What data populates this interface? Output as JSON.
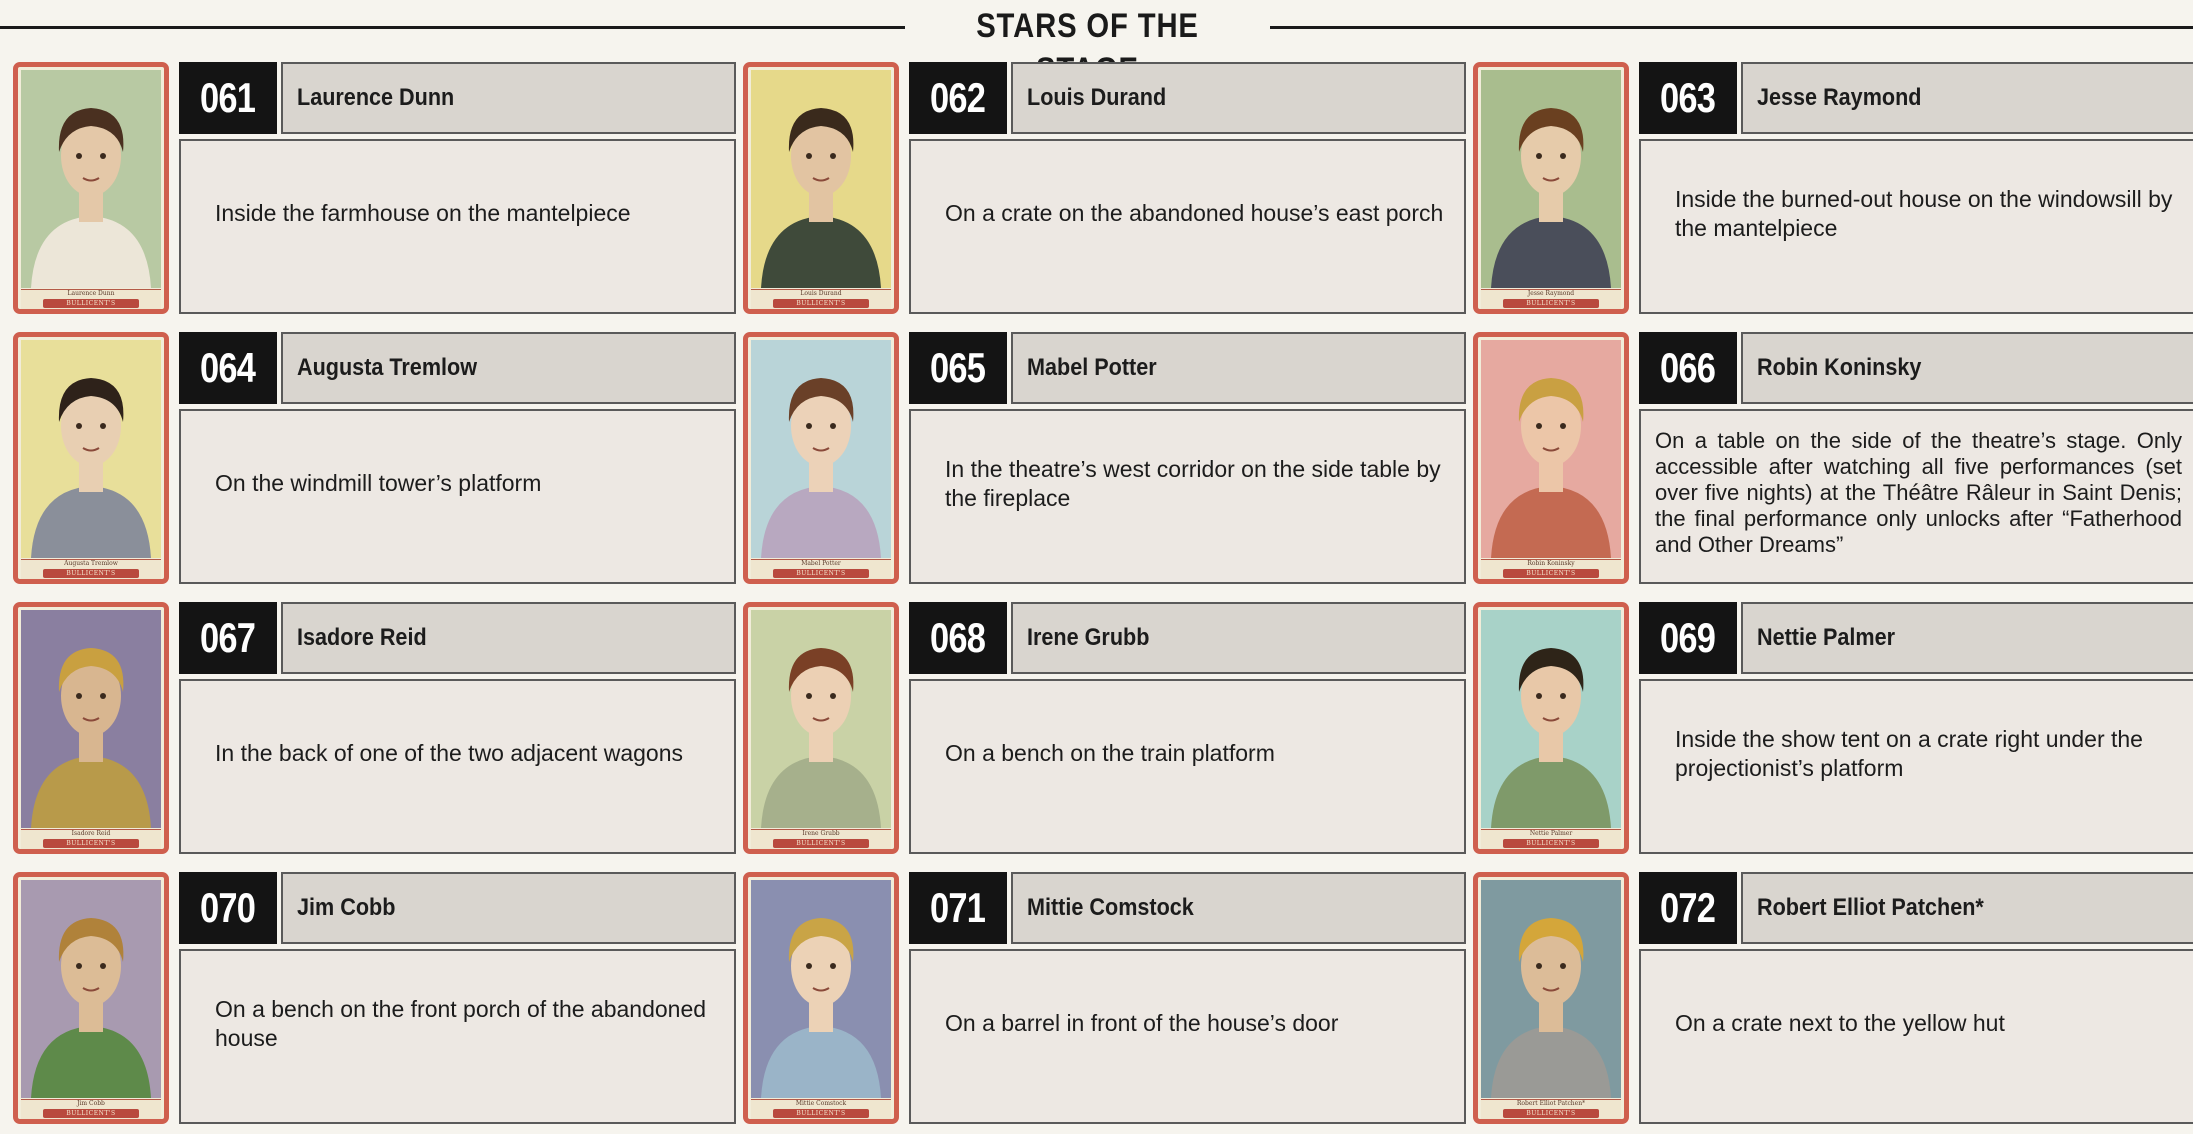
{
  "title": "STARS OF THE STAGE",
  "card_brand": "BULLICENT'S",
  "entries": [
    {
      "number": "061",
      "name": "Laurence Dunn",
      "location": "Inside the farmhouse on the mantelpiece",
      "bg": "#b8c9a3",
      "skin": "#e4c8a8",
      "hair": "#4a3020",
      "cloth": "#ece6d8"
    },
    {
      "number": "062",
      "name": "Louis Durand",
      "location": "On a crate on the abandoned house’s east porch",
      "bg": "#e6d98a",
      "skin": "#e2c4a2",
      "hair": "#3a2a1c",
      "cloth": "#3f4a3a"
    },
    {
      "number": "063",
      "name": "Jesse Raymond",
      "location": "Inside the burned-out house on the windowsill by the mantelpiece",
      "bg": "#a9bd8e",
      "skin": "#e6cbaa",
      "hair": "#6a4020",
      "cloth": "#4a4e5a"
    },
    {
      "number": "064",
      "name": "Augusta Tremlow",
      "location": "On the windmill tower’s platform",
      "bg": "#e8df9a",
      "skin": "#e8cfb2",
      "hair": "#2e221a",
      "cloth": "#8a8f9a"
    },
    {
      "number": "065",
      "name": "Mabel Potter",
      "location": "In the theatre’s west corridor on the side table by the fireplace",
      "bg": "#b9d4d8",
      "skin": "#ecd2b8",
      "hair": "#6a4028",
      "cloth": "#b8a8c0"
    },
    {
      "number": "066",
      "name": "Robin Koninsky",
      "location": "On a table on the side of the theatre’s stage. Only accessible after watching all five performances (set over five nights) at the Théâtre Râleur in Saint Denis; the final performance only unlocks after “Fatherhood and Other Dreams”",
      "bg": "#e6a9a0",
      "skin": "#ecc6a8",
      "hair": "#c9a042",
      "cloth": "#c46a52"
    },
    {
      "number": "067",
      "name": "Isadore Reid",
      "location": "In the back of one of the two adjacent wagons",
      "bg": "#8a7fa0",
      "skin": "#d8b690",
      "hair": "#c9a040",
      "cloth": "#b89a4a"
    },
    {
      "number": "068",
      "name": "Irene Grubb",
      "location": "On a bench on the train platform",
      "bg": "#c9d2a6",
      "skin": "#ecd0b4",
      "hair": "#7a4026",
      "cloth": "#a6b08c"
    },
    {
      "number": "069",
      "name": "Nettie Palmer",
      "location": "Inside the show tent on a crate right under the projectionist’s platform",
      "bg": "#a8d2c8",
      "skin": "#e8c8a8",
      "hair": "#2e2418",
      "cloth": "#7f9a6a"
    },
    {
      "number": "070",
      "name": "Jim Cobb",
      "location": "On a bench on the front porch of the abandoned house",
      "bg": "#a89ab0",
      "skin": "#dcbc96",
      "hair": "#b0823a",
      "cloth": "#5e8a4a"
    },
    {
      "number": "071",
      "name": "Mittie Comstock",
      "location": "On a barrel in front of the house’s door",
      "bg": "#8a8fb0",
      "skin": "#ecd2b6",
      "hair": "#c9a446",
      "cloth": "#9ab4c8"
    },
    {
      "number": "072",
      "name": "Robert Elliot Patchen*",
      "location": "On a crate next to the yellow hut",
      "bg": "#7f9aa0",
      "skin": "#dcbc98",
      "hair": "#d4a63a",
      "cloth": "#9a9a96"
    }
  ]
}
